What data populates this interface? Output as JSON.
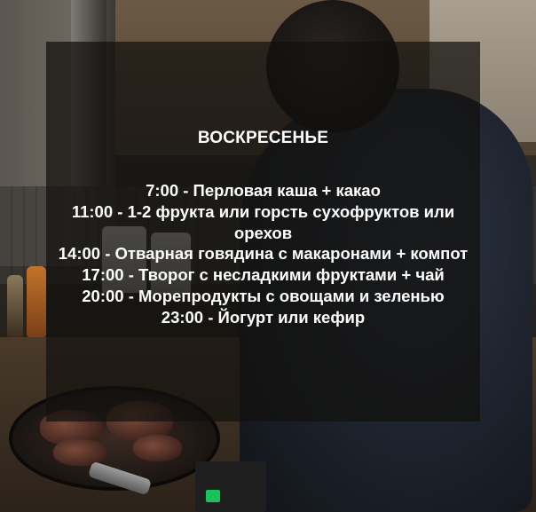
{
  "card": {
    "title": "ВОСКРЕСЕНЬЕ",
    "items": [
      "7:00 - Перловая каша + какао",
      "11:00 - 1-2 фрукта или горсть сухофруктов или орехов",
      "14:00 - Отварная говядина с макаронами + компот",
      "17:00 - Творог с несладкими фруктами + чай",
      "20:00 - Морепродукты с овощами и зеленью",
      "23:00 - Йогурт или кефир"
    ]
  },
  "colors": {
    "overlay": "#12100e",
    "text": "#ffffff",
    "stove_display": "#17c35a"
  }
}
